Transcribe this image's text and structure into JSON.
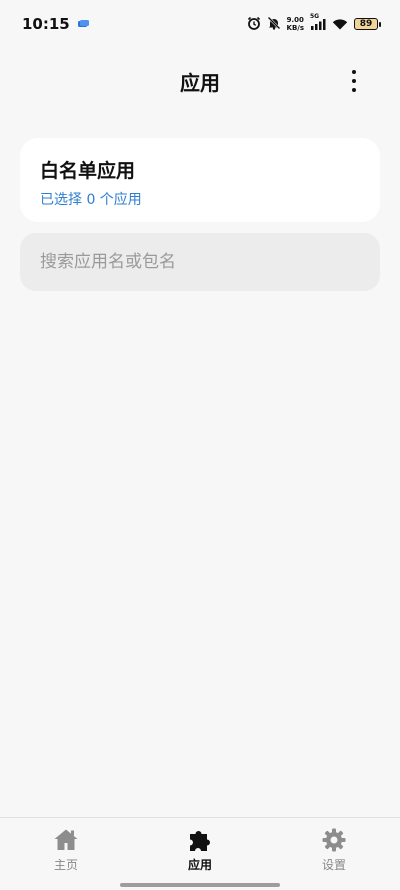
{
  "status_bar": {
    "time": "10:15",
    "net_speed_value": "9.00",
    "net_speed_unit": "KB/s",
    "signal_label": "5G",
    "battery": "89",
    "icons": [
      "message-icon",
      "alarm-icon",
      "mute-icon",
      "signal-icon",
      "wifi-icon",
      "battery-icon"
    ]
  },
  "header": {
    "title": "应用",
    "more_icon": "more-vertical-icon"
  },
  "whitelist": {
    "title": "白名单应用",
    "subtitle": "已选择 0 个应用",
    "subtitle_color": "#2f7fd1"
  },
  "search": {
    "placeholder": "搜索应用名或包名",
    "value": ""
  },
  "bottom_nav": {
    "items": [
      {
        "label": "主页",
        "icon": "home-icon",
        "active": false
      },
      {
        "label": "应用",
        "icon": "puzzle-icon",
        "active": true
      },
      {
        "label": "设置",
        "icon": "gear-icon",
        "active": false
      }
    ]
  }
}
